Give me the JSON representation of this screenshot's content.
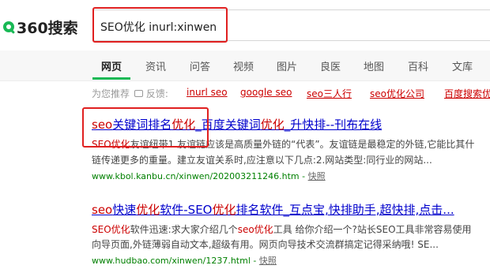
{
  "logo": {
    "text": "360搜索",
    "icon": "360-logo-ring"
  },
  "search": {
    "query": "SEO优化 inurl:xinwen"
  },
  "tabs": [
    {
      "label": "网页",
      "active": true
    },
    {
      "label": "资讯"
    },
    {
      "label": "问答"
    },
    {
      "label": "视频"
    },
    {
      "label": "图片"
    },
    {
      "label": "良医"
    },
    {
      "label": "地图"
    },
    {
      "label": "百科"
    },
    {
      "label": "文库"
    }
  ],
  "recommend": {
    "label": "为您推荐",
    "feedback": "反馈:",
    "links": [
      "inurl seo",
      "google seo",
      "seo三人行",
      "seo优化公司",
      "百度搜索优"
    ]
  },
  "results": [
    {
      "title_parts": [
        "seo",
        "关键词排名",
        "优化",
        "_百度关键词",
        "优化",
        "_升快排--刊布在线"
      ],
      "snippet1_parts": [
        "SEO优化",
        "友谊纽带1.友谊链应该是高质量外链的“代表”。友谊链是最稳定的外链,它能比其什"
      ],
      "snippet2": "链传递更多的重量。建立友谊关系时,应注意以下几点:2.网站类型:同行业的网站...",
      "url": "www.kbol.kanbu.cn/xinwen/202003211246.htm",
      "separator": " - ",
      "snapshot": "快照"
    },
    {
      "title_parts": [
        "seo",
        "快速",
        "优化",
        "软件-SEO",
        "优化",
        "排名软件_互点宝,快排助手,超快排,点击..."
      ],
      "snippet1_parts": [
        "SEO优化",
        "软件迅速:求大家介绍几个",
        "seo优化",
        "工具 给你介绍一个?站长SEO工具非常容易使用"
      ],
      "snippet2": "向导页面,外链薄弱自动文本,超级有用。网页向导技术交流群搞定记得采纳哦! SE...",
      "url": "www.hudbao.com/xinwen/1237.html",
      "separator": " - ",
      "snapshot": "快照"
    }
  ],
  "colors": {
    "brand": "#19b955",
    "link": "#0000cc",
    "highlight": "#cc0000",
    "url": "#008000",
    "annotation": "#e02020"
  }
}
